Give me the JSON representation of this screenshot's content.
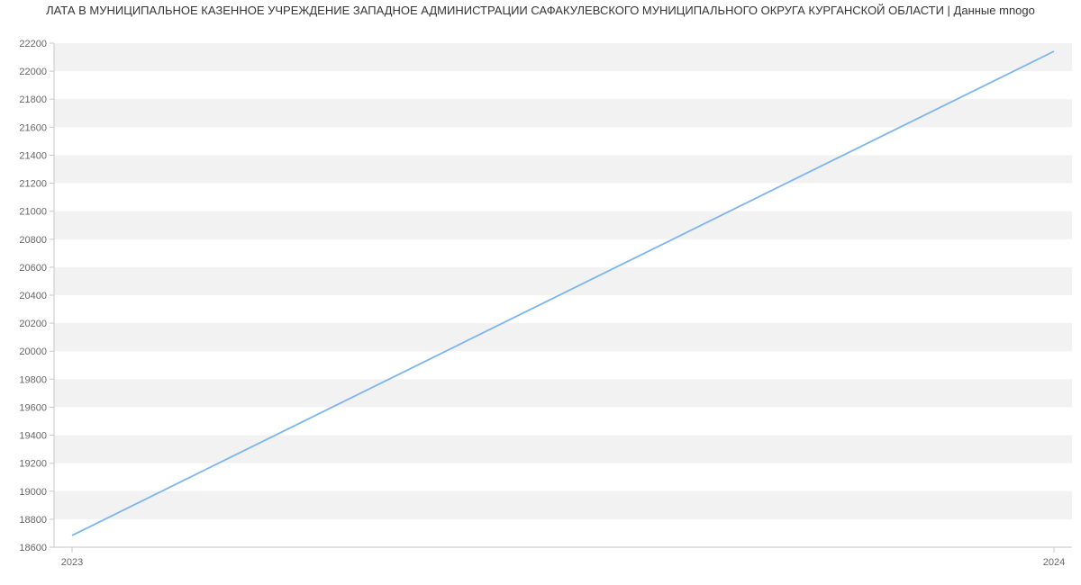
{
  "title": "ЛАТА В МУНИЦИПАЛЬНОЕ КАЗЕННОЕ УЧРЕЖДЕНИЕ ЗАПАДНОЕ АДМИНИСТРАЦИИ САФАКУЛЕВСКОГО МУНИЦИПАЛЬНОГО ОКРУГА КУРГАНСКОЙ ОБЛАСТИ | Данные mnogo",
  "chart_data": {
    "type": "line",
    "title": "ЛАТА В МУНИЦИПАЛЬНОЕ КАЗЕННОЕ УЧРЕЖДЕНИЕ ЗАПАДНОЕ АДМИНИСТРАЦИИ САФАКУЛЕВСКОГО МУНИЦИПАЛЬНОГО ОКРУГА КУРГАНСКОЙ ОБЛАСТИ | Данные mnogo",
    "xlabel": "",
    "ylabel": "",
    "x_ticks": [
      "2023",
      "2024"
    ],
    "y_ticks": [
      18600,
      18800,
      19000,
      19200,
      19400,
      19600,
      19800,
      20000,
      20200,
      20400,
      20600,
      20800,
      21000,
      21200,
      21400,
      21600,
      21800,
      22000,
      22200
    ],
    "ylim": [
      18600,
      22200
    ],
    "series": [
      {
        "name": "",
        "x": [
          "2023",
          "2024"
        ],
        "values": [
          18684,
          22142
        ]
      }
    ]
  }
}
